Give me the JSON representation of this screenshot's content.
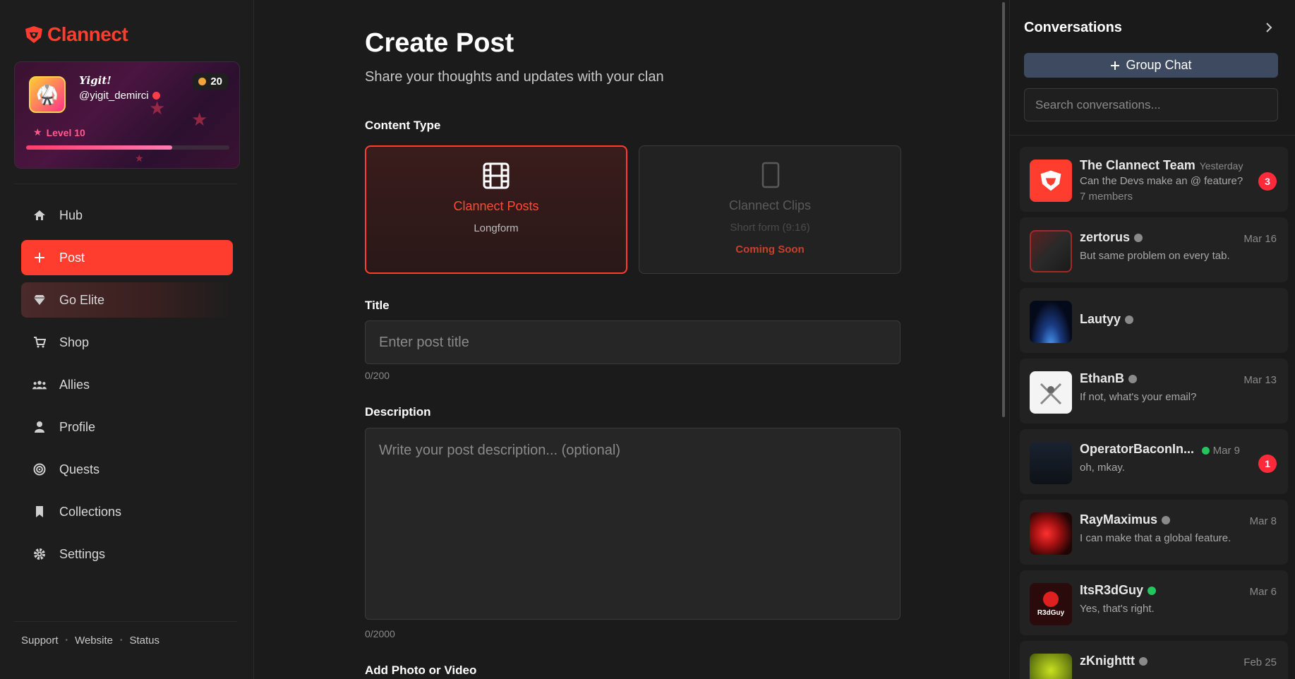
{
  "brand": {
    "name": "Clannect",
    "color": "#ff3d2e"
  },
  "profile": {
    "display_name": "Yigit!",
    "handle": "@yigit_demirci",
    "coins": "20",
    "level": "Level 10",
    "xp_progress": 0.72
  },
  "nav": {
    "items": [
      {
        "label": "Hub",
        "icon": "home-icon"
      },
      {
        "label": "Post",
        "icon": "plus-icon",
        "active": true
      },
      {
        "label": "Go Elite",
        "icon": "diamond-icon"
      },
      {
        "label": "Shop",
        "icon": "cart-icon"
      },
      {
        "label": "Allies",
        "icon": "users-icon"
      },
      {
        "label": "Profile",
        "icon": "user-icon"
      },
      {
        "label": "Quests",
        "icon": "target-icon"
      },
      {
        "label": "Collections",
        "icon": "bookmark-icon"
      },
      {
        "label": "Settings",
        "icon": "gear-icon"
      }
    ]
  },
  "footer": {
    "support": "Support",
    "website": "Website",
    "status": "Status"
  },
  "main": {
    "title": "Create Post",
    "subtitle": "Share your thoughts and updates with your clan",
    "content_type_label": "Content Type",
    "types": {
      "posts": {
        "name": "Clannect Posts",
        "sub": "Longform"
      },
      "clips": {
        "name": "Clannect Clips",
        "sub": "Short form (9:16)",
        "soon": "Coming Soon"
      }
    },
    "title_label": "Title",
    "title_placeholder": "Enter post title",
    "title_counter": "0/200",
    "description_label": "Description",
    "description_placeholder": "Write your post description... (optional)",
    "description_counter": "0/2000",
    "media_label": "Add Photo or Video"
  },
  "conversations": {
    "title": "Conversations",
    "group_chat": "Group Chat",
    "search_placeholder": "Search conversations...",
    "list": [
      {
        "name": "The Clannect Team",
        "date": "Yesterday",
        "message": "Can the Devs make an @ feature?",
        "members": "7 members",
        "unread": "3"
      },
      {
        "name": "zertorus",
        "date": "Mar 16",
        "message": "But same problem on every tab.",
        "status": "offline"
      },
      {
        "name": "Lautyy",
        "status": "offline"
      },
      {
        "name": "EthanB",
        "date": "Mar 13",
        "message": "If not, what's your email?",
        "status": "offline"
      },
      {
        "name": "OperatorBaconIn...",
        "date": "Mar 9",
        "message": "oh, mkay.",
        "status": "online",
        "unread": "1"
      },
      {
        "name": "RayMaximus",
        "date": "Mar 8",
        "message": "I can make that a global feature.",
        "status": "offline"
      },
      {
        "name": "ItsR3dGuy",
        "date": "Mar 6",
        "message": "Yes, that's right.",
        "status": "online",
        "avatar_text": "R3dGuy"
      },
      {
        "name": "zKnighttt",
        "date": "Feb 25",
        "status": "offline"
      }
    ]
  },
  "colors": {
    "accent": "#ff3d2e",
    "online": "#22c55e",
    "offline": "#8a8a8a"
  }
}
